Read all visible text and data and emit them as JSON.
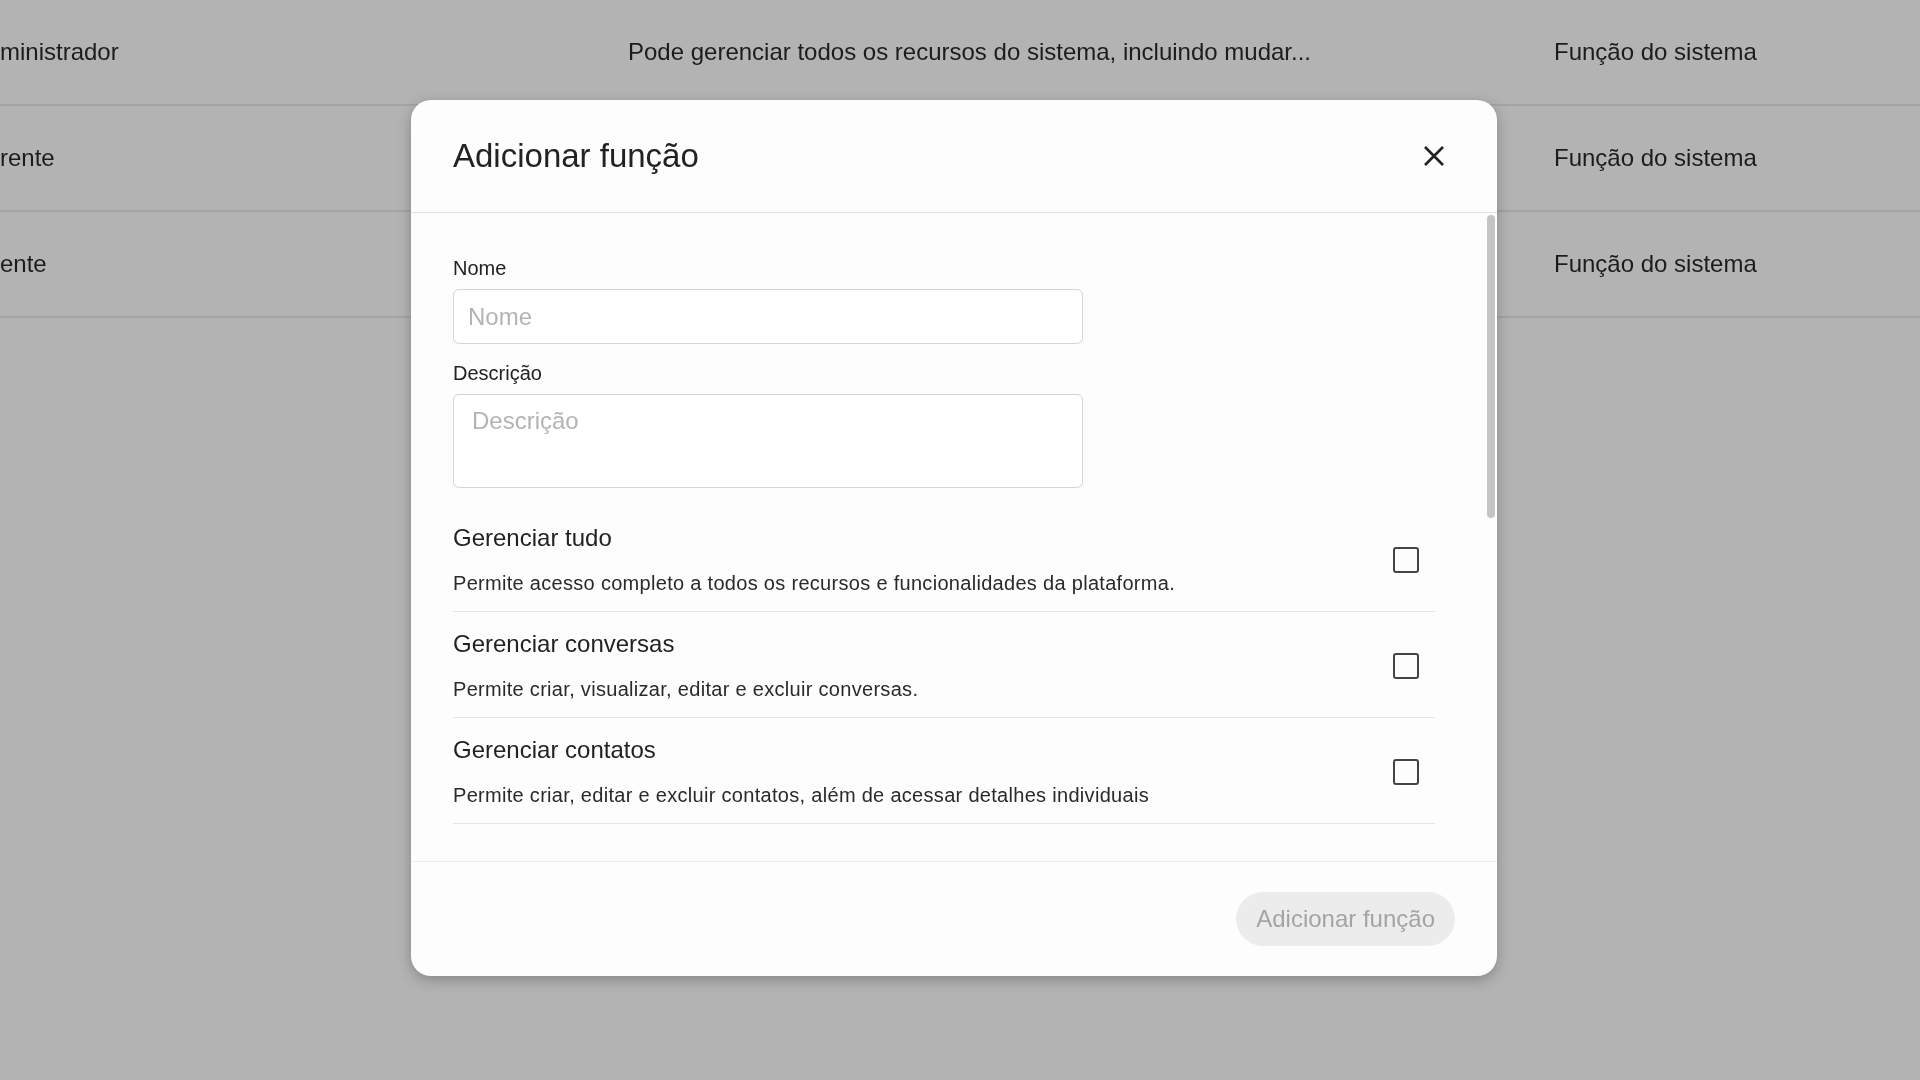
{
  "table": {
    "rows": [
      {
        "name": "ministrador",
        "description": "Pode gerenciar todos os recursos do sistema, incluindo mudar...",
        "type": "Função do sistema"
      },
      {
        "name": "rente",
        "description": "",
        "type": "Função do sistema"
      },
      {
        "name": "ente",
        "description": "",
        "type": "Função do sistema"
      }
    ]
  },
  "dialog": {
    "title": "Adicionar função",
    "fields": [
      {
        "kind": "input",
        "label": "Nome",
        "placeholder": "Nome"
      },
      {
        "kind": "textarea",
        "label": "Descrição",
        "placeholder": "Descrição"
      }
    ],
    "permissions": [
      {
        "title": "Gerenciar tudo",
        "description": "Permite acesso completo a todos os recursos e funcionalidades da plataforma.",
        "checked": false
      },
      {
        "title": "Gerenciar conversas",
        "description": "Permite criar, visualizar, editar e excluir conversas.",
        "checked": false
      },
      {
        "title": "Gerenciar contatos",
        "description": "Permite criar, editar e excluir contatos, além de acessar detalhes individuais",
        "checked": false
      }
    ],
    "submit": {
      "label": "Adicionar função",
      "disabled": true
    }
  }
}
